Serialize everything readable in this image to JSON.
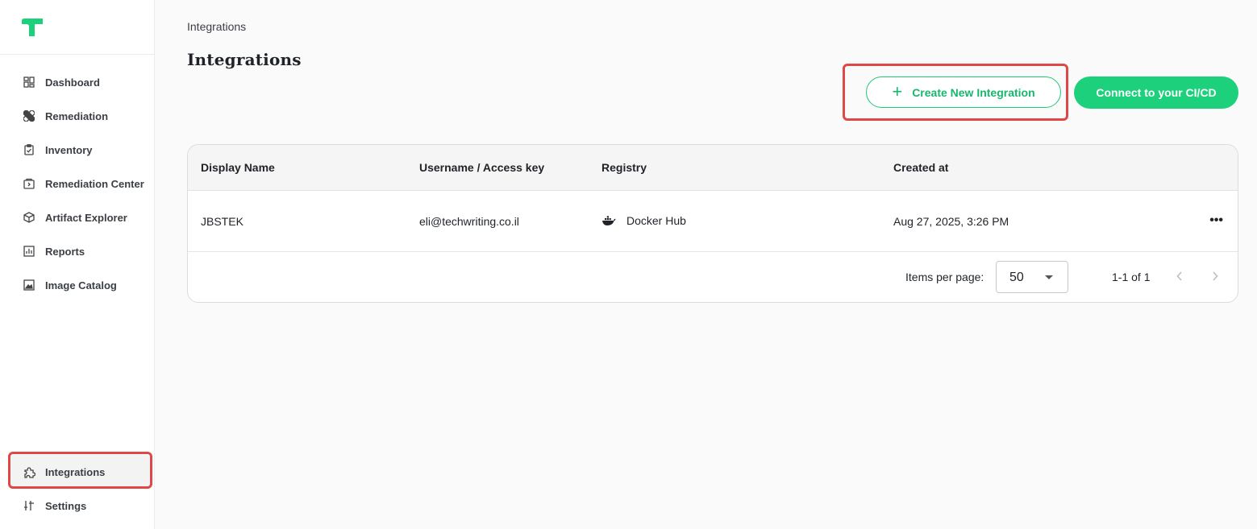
{
  "app": {
    "logo": "green-brand-logo"
  },
  "sidebar": {
    "items": [
      {
        "label": "Dashboard",
        "icon": "dashboard-grid-icon"
      },
      {
        "label": "Remediation",
        "icon": "bandage-icon"
      },
      {
        "label": "Inventory",
        "icon": "clipboard-check-icon"
      },
      {
        "label": "Remediation Center",
        "icon": "folder-arrow-icon"
      },
      {
        "label": "Artifact Explorer",
        "icon": "cube-icon"
      },
      {
        "label": "Reports",
        "icon": "bar-chart-icon"
      },
      {
        "label": "Image Catalog",
        "icon": "image-icon"
      }
    ],
    "bottom": [
      {
        "label": "Integrations",
        "icon": "puzzle-icon",
        "active": true
      },
      {
        "label": "Settings",
        "icon": "sliders-icon"
      }
    ]
  },
  "header": {
    "breadcrumb": "Integrations",
    "title": "Integrations"
  },
  "actions": {
    "create_label": "Create New Integration",
    "create_icon": "plus-icon",
    "connect_label": "Connect to your CI/CD"
  },
  "table": {
    "columns": [
      "Display Name",
      "Username / Access key",
      "Registry",
      "Created at"
    ],
    "rows": [
      {
        "display_name": "JBSTEK",
        "username": "eli@techwriting.co.il",
        "registry": "Docker Hub",
        "registry_icon": "docker-whale-icon",
        "created_at": "Aug 27, 2025, 3:26 PM",
        "menu": "•••"
      }
    ]
  },
  "pagination": {
    "items_per_page_label": "Items per page:",
    "items_per_page_value": "50",
    "range": "1-1 of 1"
  },
  "colors": {
    "accent": "#1dd07c",
    "highlight": "#e04848"
  }
}
